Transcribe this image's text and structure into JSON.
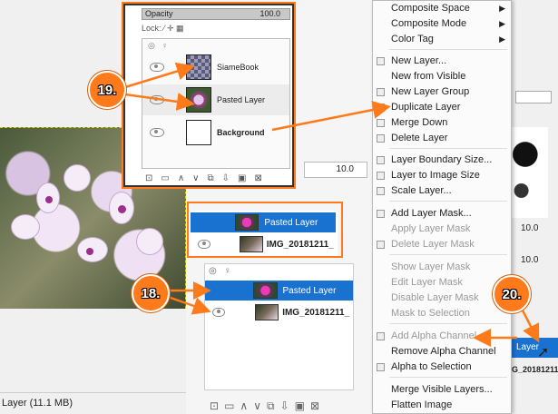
{
  "status": {
    "text": "Layer (11.1 MB)"
  },
  "inset": {
    "opacity_label": "Opacity",
    "opacity_value": "100.0",
    "lock_label": "Lock:",
    "layers": [
      {
        "name": "SiameBook",
        "thumb": "checker"
      },
      {
        "name": "Pasted Layer",
        "thumb": "flower"
      },
      {
        "name": "Background",
        "thumb": "white"
      }
    ]
  },
  "mid": {
    "value_a": "10.0",
    "box_layers": [
      {
        "name": "Pasted Layer"
      },
      {
        "name": "IMG_20181211_"
      }
    ],
    "list_layers": [
      {
        "name": "Pasted Layer"
      },
      {
        "name": "IMG_20181211_"
      }
    ]
  },
  "right": {
    "value_a": "10.0",
    "value_b": "10.0",
    "layer_label": "Layer",
    "img_label": "G_20181211_"
  },
  "menu": {
    "items": [
      {
        "label": "Composite Space",
        "submenu": true,
        "disabled": false
      },
      {
        "label": "Composite Mode",
        "submenu": true,
        "disabled": false
      },
      {
        "label": "Color Tag",
        "submenu": true,
        "disabled": false
      },
      {
        "label": "New Layer...",
        "disabled": false
      },
      {
        "label": "New from Visible",
        "disabled": false
      },
      {
        "label": "New Layer Group",
        "disabled": false
      },
      {
        "label": "Duplicate Layer",
        "disabled": false
      },
      {
        "label": "Merge Down",
        "disabled": false
      },
      {
        "label": "Delete Layer",
        "disabled": false
      },
      {
        "label": "Layer Boundary Size...",
        "disabled": false
      },
      {
        "label": "Layer to Image Size",
        "disabled": false
      },
      {
        "label": "Scale Layer...",
        "disabled": false
      },
      {
        "label": "Add Layer Mask...",
        "disabled": false
      },
      {
        "label": "Apply Layer Mask",
        "disabled": true
      },
      {
        "label": "Delete Layer Mask",
        "disabled": true
      },
      {
        "label": "Show Layer Mask",
        "disabled": true
      },
      {
        "label": "Edit Layer Mask",
        "disabled": true
      },
      {
        "label": "Disable Layer Mask",
        "disabled": true
      },
      {
        "label": "Mask to Selection",
        "disabled": true
      },
      {
        "label": "Add Alpha Channel",
        "disabled": true
      },
      {
        "label": "Remove Alpha Channel",
        "disabled": false
      },
      {
        "label": "Alpha to Selection",
        "disabled": false
      },
      {
        "label": "Merge Visible Layers...",
        "disabled": false
      },
      {
        "label": "Flatten Image",
        "disabled": false
      }
    ]
  },
  "badges": {
    "b19": "19.",
    "b18": "18.",
    "b20": "20."
  },
  "colors": {
    "accent": "#ff7a1a",
    "selection": "#1a72d0"
  }
}
